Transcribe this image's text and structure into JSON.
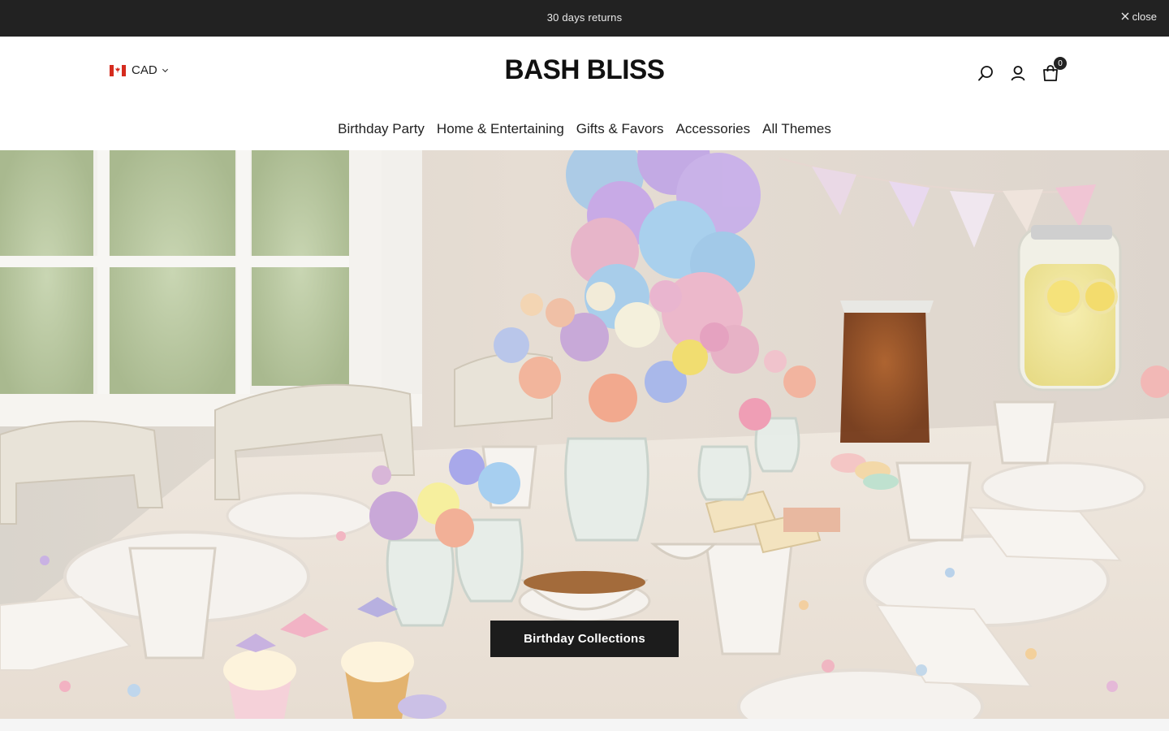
{
  "announcement": {
    "text": "30 days returns",
    "close_label": "close"
  },
  "header": {
    "currency": "CAD",
    "logo": "BASH BLISS",
    "cart_count": "0"
  },
  "nav": {
    "items": [
      {
        "label": "Birthday Party"
      },
      {
        "label": "Home & Entertaining"
      },
      {
        "label": "Gifts & Favors"
      },
      {
        "label": "Accessories"
      },
      {
        "label": "All Themes"
      }
    ]
  },
  "hero": {
    "cta_label": "Birthday Collections"
  },
  "colors": {
    "announcement_bg": "#222222",
    "button_bg": "#1c1c1c",
    "text": "#1f1f1f"
  },
  "icons": [
    "close-icon",
    "canada-flag-icon",
    "chevron-down-icon",
    "search-icon",
    "account-icon",
    "cart-icon"
  ]
}
